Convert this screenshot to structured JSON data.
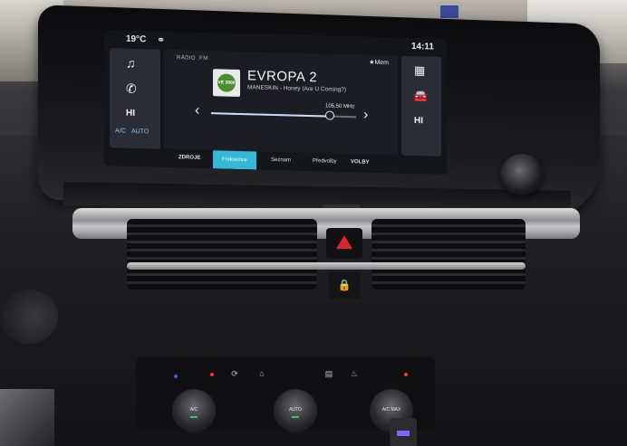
{
  "screen": {
    "temperature": "19°C",
    "time": "14:11",
    "source_label": "RÁDIO .FM",
    "memory_label": "Mem",
    "station_name": "EVROPA 2",
    "station_logo_text": "VE 3500",
    "now_playing": "MANESKIN - Honey (Are U Coming?)",
    "frequency": "105,50 MHz",
    "tuning_position_fraction": 0.82,
    "left_buttons": [
      "♫",
      "✆",
      "HI"
    ],
    "ac_label": "A/C",
    "auto_label": "AUTO",
    "right_buttons": [
      "HI"
    ],
    "tabs": [
      "ZDROJE",
      "Frekvence",
      "Seznam",
      "Předvolby"
    ],
    "active_tab": "Frekvence",
    "options_label": "VOLBY"
  },
  "climate": {
    "knobs": [
      "A/C",
      "AUTO",
      "A/C MAX"
    ]
  },
  "colors": {
    "accent_tab": "#35b7d8",
    "hazard": "#d7262b",
    "station_logo": "#4a8f2e",
    "ambient_led": "#3b63ff"
  }
}
